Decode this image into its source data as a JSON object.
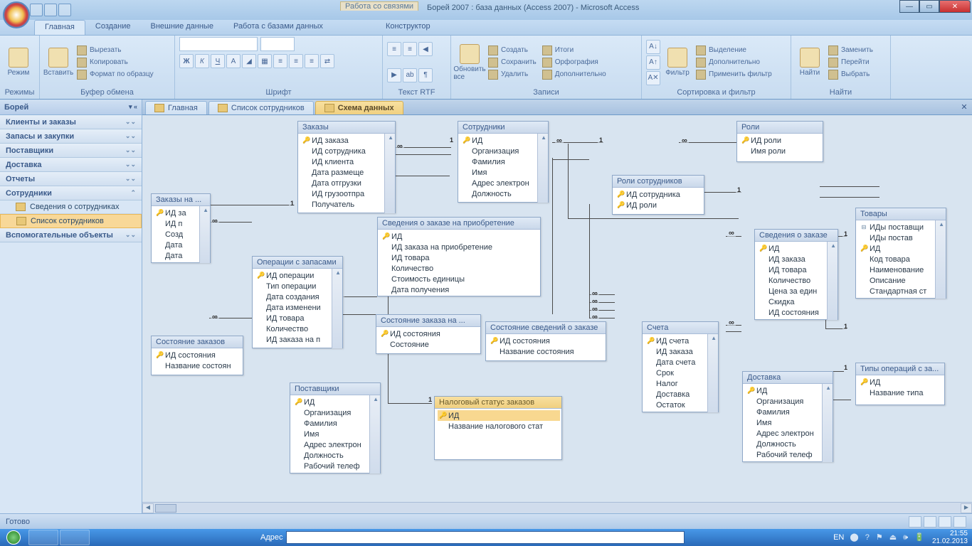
{
  "titlebar": {
    "context": "Работа со связями",
    "title": "Борей 2007 : база данных (Access 2007) - Microsoft Access"
  },
  "tabs": [
    "Главная",
    "Создание",
    "Внешние данные",
    "Работа с базами данных",
    "Конструктор"
  ],
  "ribbon": {
    "g1": {
      "label": "Режимы",
      "btn": "Режим"
    },
    "g2": {
      "label": "Буфер обмена",
      "btn": "Вставить",
      "cut": "Вырезать",
      "copy": "Копировать",
      "fmt": "Формат по образцу"
    },
    "g3": {
      "label": "Шрифт"
    },
    "g4": {
      "label": "Текст RTF"
    },
    "g5": {
      "label": "Записи",
      "refresh": "Обновить все",
      "new": "Создать",
      "save": "Сохранить",
      "del": "Удалить",
      "totals": "Итоги",
      "spell": "Орфография",
      "more": "Дополнительно"
    },
    "g6": {
      "label": "Сортировка и фильтр",
      "filter": "Фильтр",
      "sel": "Выделение",
      "adv": "Дополнительно",
      "toggle": "Применить фильтр"
    },
    "g7": {
      "label": "Найти",
      "find": "Найти",
      "replace": "Заменить",
      "goto": "Перейти",
      "select": "Выбрать"
    }
  },
  "nav": {
    "title": "Борей",
    "groups": [
      {
        "name": "Клиенты и заказы"
      },
      {
        "name": "Запасы и закупки"
      },
      {
        "name": "Поставщики"
      },
      {
        "name": "Доставка"
      },
      {
        "name": "Отчеты"
      },
      {
        "name": "Сотрудники",
        "open": true,
        "items": [
          "Сведения о сотрудниках",
          "Список сотрудников"
        ]
      },
      {
        "name": "Вспомогательные объекты"
      }
    ]
  },
  "doc_tabs": [
    {
      "label": "Главная"
    },
    {
      "label": "Список сотрудников"
    },
    {
      "label": "Схема данных",
      "active": true
    }
  ],
  "tables": {
    "zakazy_na": {
      "title": "Заказы на ...",
      "fields": [
        {
          "k": 1,
          "n": "ИД за"
        },
        {
          "n": "ИД п"
        },
        {
          "n": "Созд"
        },
        {
          "n": "Дата"
        },
        {
          "n": "Дата"
        }
      ]
    },
    "zakazy": {
      "title": "Заказы",
      "fields": [
        {
          "k": 1,
          "n": "ИД заказа"
        },
        {
          "n": "ИД сотрудника"
        },
        {
          "n": "ИД клиента"
        },
        {
          "n": "Дата размеще"
        },
        {
          "n": "Дата отгрузки"
        },
        {
          "n": "ИД грузоотпра"
        },
        {
          "n": "Получатель"
        }
      ]
    },
    "sotrudniki": {
      "title": "Сотрудники",
      "fields": [
        {
          "k": 1,
          "n": "ИД"
        },
        {
          "n": "Организация"
        },
        {
          "n": "Фамилия"
        },
        {
          "n": "Имя"
        },
        {
          "n": "Адрес электрон"
        },
        {
          "n": "Должность"
        }
      ]
    },
    "roli": {
      "title": "Роли",
      "fields": [
        {
          "k": 1,
          "n": "ИД роли"
        },
        {
          "n": "Имя роли"
        }
      ]
    },
    "roli_sotr": {
      "title": "Роли сотрудников",
      "fields": [
        {
          "k": 1,
          "n": "ИД сотрудника"
        },
        {
          "k": 1,
          "n": "ИД роли"
        }
      ]
    },
    "oper_zap": {
      "title": "Операции с запасами",
      "fields": [
        {
          "k": 1,
          "n": "ИД операции"
        },
        {
          "n": "Тип операции"
        },
        {
          "n": "Дата создания"
        },
        {
          "n": "Дата изменени"
        },
        {
          "n": "ИД товара"
        },
        {
          "n": "Количество"
        },
        {
          "n": "ИД заказа на п"
        }
      ]
    },
    "sved_priobr": {
      "title": "Сведения о заказе на приобретение",
      "fields": [
        {
          "k": 1,
          "n": "ИД"
        },
        {
          "n": "ИД заказа на приобретение"
        },
        {
          "n": "ИД товара"
        },
        {
          "n": "Количество"
        },
        {
          "n": "Стоимость единицы"
        },
        {
          "n": "Дата получения"
        }
      ]
    },
    "sost_zak": {
      "title": "Состояние заказов",
      "fields": [
        {
          "k": 1,
          "n": "ИД состояния"
        },
        {
          "n": "Название состоян"
        }
      ]
    },
    "sost_zak_na": {
      "title": "Состояние заказа на ...",
      "fields": [
        {
          "k": 1,
          "n": "ИД состояния"
        },
        {
          "n": "Состояние"
        }
      ]
    },
    "sost_sved": {
      "title": "Состояние сведений о заказе",
      "fields": [
        {
          "k": 1,
          "n": "ИД состояния"
        },
        {
          "n": "Название состояния"
        }
      ]
    },
    "nalog": {
      "title": "Налоговый статус заказов",
      "fields": [
        {
          "k": 1,
          "n": "ИД",
          "sel": true
        },
        {
          "n": "Название налогового стат"
        }
      ]
    },
    "postavshiki": {
      "title": "Поставщики",
      "fields": [
        {
          "k": 1,
          "n": "ИД"
        },
        {
          "n": "Организация"
        },
        {
          "n": "Фамилия"
        },
        {
          "n": "Имя"
        },
        {
          "n": "Адрес электрон"
        },
        {
          "n": "Должность"
        },
        {
          "n": "Рабочий телеф"
        }
      ]
    },
    "sved_zak": {
      "title": "Сведения о заказе",
      "fields": [
        {
          "k": 1,
          "n": "ИД"
        },
        {
          "n": "ИД заказа"
        },
        {
          "n": "ИД товара"
        },
        {
          "n": "Количество"
        },
        {
          "n": "Цена за един"
        },
        {
          "n": "Скидка"
        },
        {
          "n": "ИД состояния"
        }
      ]
    },
    "scheta": {
      "title": "Счета",
      "fields": [
        {
          "k": 1,
          "n": "ИД счета"
        },
        {
          "n": "ИД заказа"
        },
        {
          "n": "Дата счета"
        },
        {
          "n": "Срок"
        },
        {
          "n": "Налог"
        },
        {
          "n": "Доставка"
        },
        {
          "n": "Остаток"
        }
      ]
    },
    "dostavka": {
      "title": "Доставка",
      "fields": [
        {
          "k": 1,
          "n": "ИД"
        },
        {
          "n": "Организация"
        },
        {
          "n": "Фамилия"
        },
        {
          "n": "Имя"
        },
        {
          "n": "Адрес электрон"
        },
        {
          "n": "Должность"
        },
        {
          "n": "Рабочий телеф"
        }
      ]
    },
    "tovary": {
      "title": "Товары",
      "fields": [
        {
          "e": 1,
          "n": "ИДы поставщи"
        },
        {
          "n": "ИДы постав"
        },
        {
          "k": 1,
          "n": "ИД"
        },
        {
          "n": "Код товара"
        },
        {
          "n": "Наименование"
        },
        {
          "n": "Описание"
        },
        {
          "n": "Стандартная ст"
        }
      ]
    },
    "tipy_oper": {
      "title": "Типы операций с за...",
      "fields": [
        {
          "k": 1,
          "n": "ИД"
        },
        {
          "n": "Название типа"
        }
      ]
    }
  },
  "statusbar": {
    "ready": "Готово"
  },
  "taskbar": {
    "addr": "Адрес",
    "time": "21:55",
    "date": "21.02.2013",
    "lang": "EN"
  }
}
